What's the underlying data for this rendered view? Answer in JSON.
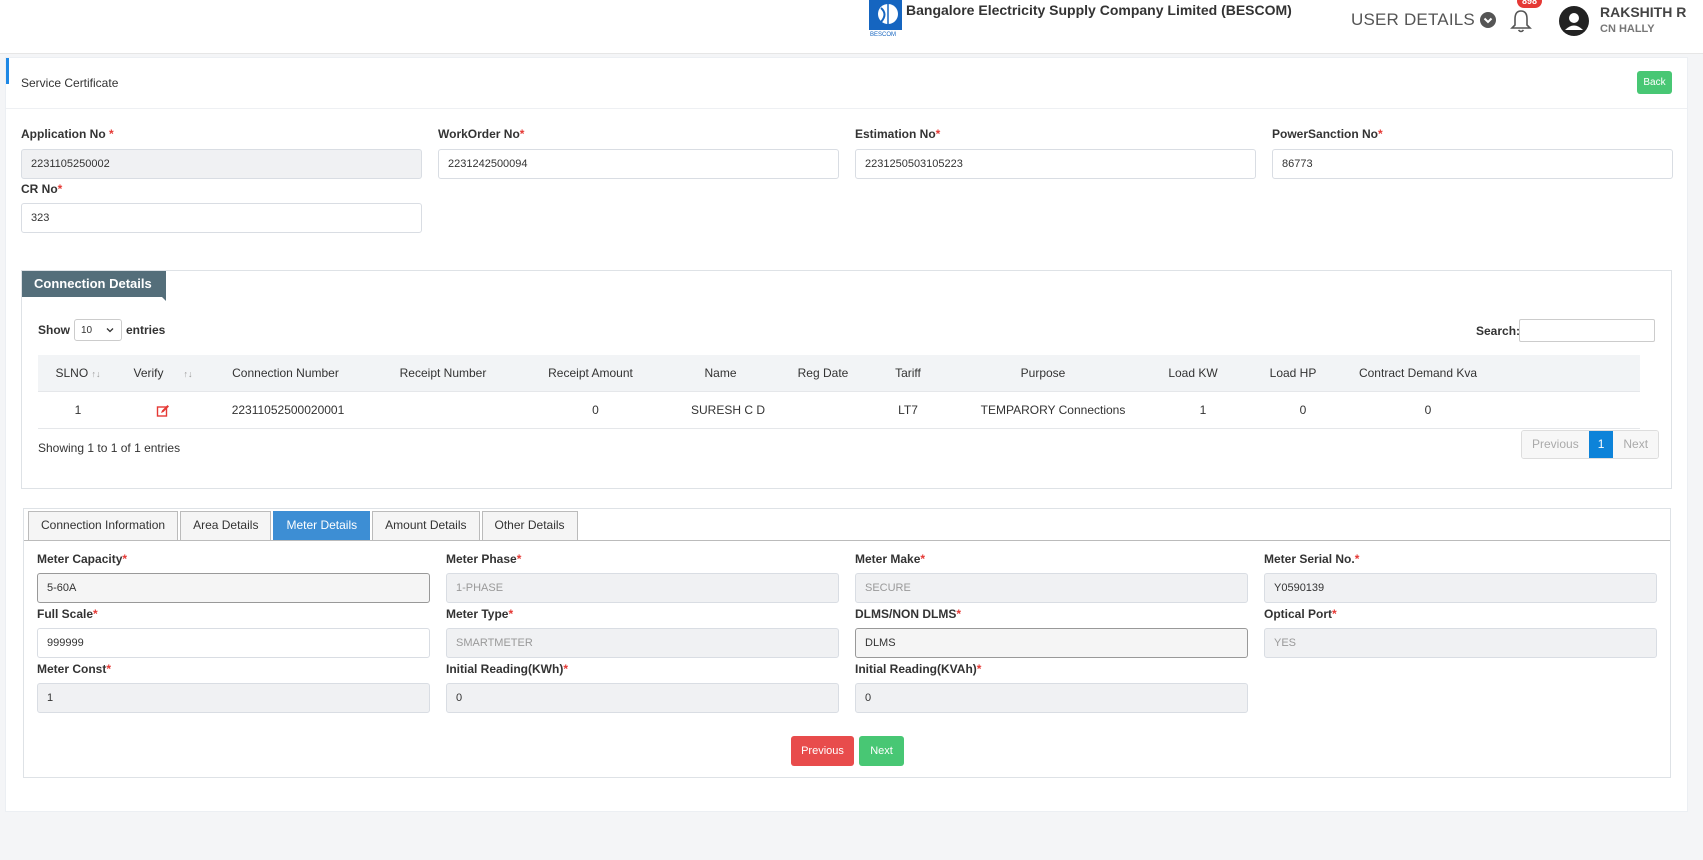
{
  "header": {
    "company": "Bangalore Electricity Supply Company Limited (BESCOM)",
    "logo_text": "BESCOM",
    "user_details_label": "USER DETAILS",
    "notification_count": "898",
    "user_name": "RAKSHITH R",
    "user_location": "CN HALLY"
  },
  "page": {
    "title": "Service Certificate",
    "back_label": "Back"
  },
  "form": {
    "application_no": {
      "label": "Application No",
      "value": "2231105250002"
    },
    "workorder_no": {
      "label": "WorkOrder No",
      "value": "2231242500094"
    },
    "estimation_no": {
      "label": "Estimation No",
      "value": "2231250503105223"
    },
    "powersanction_no": {
      "label": "PowerSanction No",
      "value": "86773"
    },
    "cr_no": {
      "label": "CR No",
      "value": "323"
    },
    "required_mark": "*"
  },
  "connection": {
    "title": "Connection Details",
    "show_label": "Show",
    "entries_value": "10",
    "entries_label": "entries",
    "search_label": "Search:",
    "columns": [
      "SLNO",
      "Verify",
      "Connection Number",
      "Receipt Number",
      "Receipt Amount",
      "Name",
      "Reg Date",
      "Tariff",
      "Purpose",
      "Load KW",
      "Load HP",
      "Contract Demand Kva"
    ],
    "rows": [
      {
        "slno": "1",
        "connection_number": "22311052500020001",
        "receipt_number": "",
        "receipt_amount": "0",
        "name": "SURESH C D",
        "reg_date": "",
        "tariff": "LT7",
        "purpose": "TEMPARORY Connections",
        "load_kw": "1",
        "load_hp": "0",
        "contract_demand": "0"
      }
    ],
    "showing": "Showing 1 to 1 of 1 entries",
    "pager": {
      "previous": "Previous",
      "current": "1",
      "next": "Next"
    }
  },
  "tabs": [
    "Connection Information",
    "Area Details",
    "Meter Details",
    "Amount Details",
    "Other Details"
  ],
  "meter": {
    "meter_capacity": {
      "label": "Meter Capacity",
      "value": "5-60A"
    },
    "meter_phase": {
      "label": "Meter Phase",
      "value": "1-PHASE"
    },
    "meter_make": {
      "label": "Meter Make",
      "value": "SECURE"
    },
    "meter_serial": {
      "label": "Meter Serial No.",
      "value": "Y0590139"
    },
    "full_scale": {
      "label": "Full Scale",
      "value": "999999"
    },
    "meter_type": {
      "label": "Meter Type",
      "value": "SMARTMETER"
    },
    "dlms": {
      "label": "DLMS/NON DLMS",
      "value": "DLMS"
    },
    "optical_port": {
      "label": "Optical Port",
      "value": "YES"
    },
    "meter_const": {
      "label": "Meter Const",
      "value": "1"
    },
    "initial_kwh": {
      "label": "Initial Reading(KWh)",
      "value": "0"
    },
    "initial_kvah": {
      "label": "Initial Reading(KVAh)",
      "value": "0"
    }
  },
  "buttons": {
    "previous": "Previous",
    "next": "Next"
  },
  "colors": {
    "accent": "#1e88e5",
    "tag": "#546e7a",
    "tab_active": "#3d8ed4",
    "success": "#48c774",
    "danger": "#e84c4c"
  }
}
